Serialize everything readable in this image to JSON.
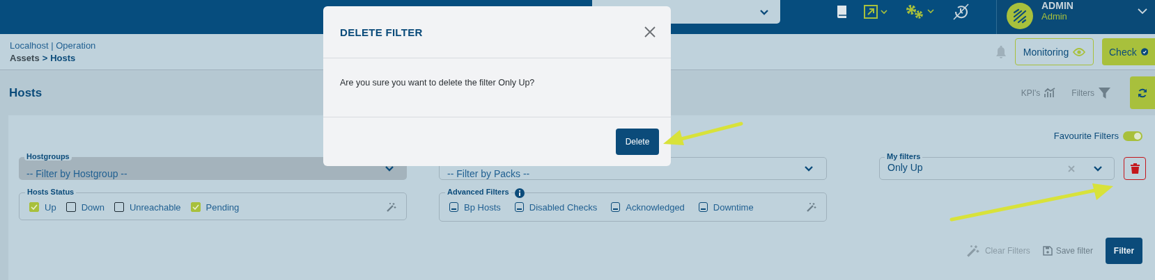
{
  "topbar": {
    "user": {
      "name": "ADMIN",
      "role": "Admin"
    }
  },
  "breadcrumb": {
    "context": "Localhost | Operation",
    "parent": "Assets",
    "separator": ">",
    "current": "Hosts"
  },
  "header_buttons": [
    {
      "label": "Monitoring",
      "kind": "outline"
    },
    {
      "label": "Check",
      "kind": "filled"
    }
  ],
  "page_title": "Hosts",
  "toolbar": {
    "kpis": "KPI's",
    "filters": "Filters"
  },
  "favourite_filters": {
    "label": "Favourite Filters",
    "on": true
  },
  "hostgroups": {
    "label": "Hostgroups",
    "placeholder": "-- Filter by Hostgroup --"
  },
  "packs": {
    "placeholder": "-- Filter by Packs --"
  },
  "my_filters": {
    "label": "My filters",
    "value": "Only Up"
  },
  "hosts_status": {
    "label": "Hosts Status",
    "options": [
      {
        "label": "Up",
        "checked": true
      },
      {
        "label": "Down",
        "checked": false
      },
      {
        "label": "Unreachable",
        "checked": false
      },
      {
        "label": "Pending",
        "checked": true
      }
    ]
  },
  "advanced_filters": {
    "label": "Advanced Filters",
    "options": [
      {
        "label": "Bp Hosts",
        "indeterminate": true
      },
      {
        "label": "Disabled Checks",
        "indeterminate": true
      },
      {
        "label": "Acknowledged",
        "indeterminate": true
      },
      {
        "label": "Downtime",
        "indeterminate": true
      }
    ]
  },
  "actions": {
    "clear": "Clear Filters",
    "save": "Save filter",
    "filter": "Filter"
  },
  "modal": {
    "title": "DELETE FILTER",
    "message": "Are you sure you want to delete the filter Only Up?",
    "confirm": "Delete"
  }
}
